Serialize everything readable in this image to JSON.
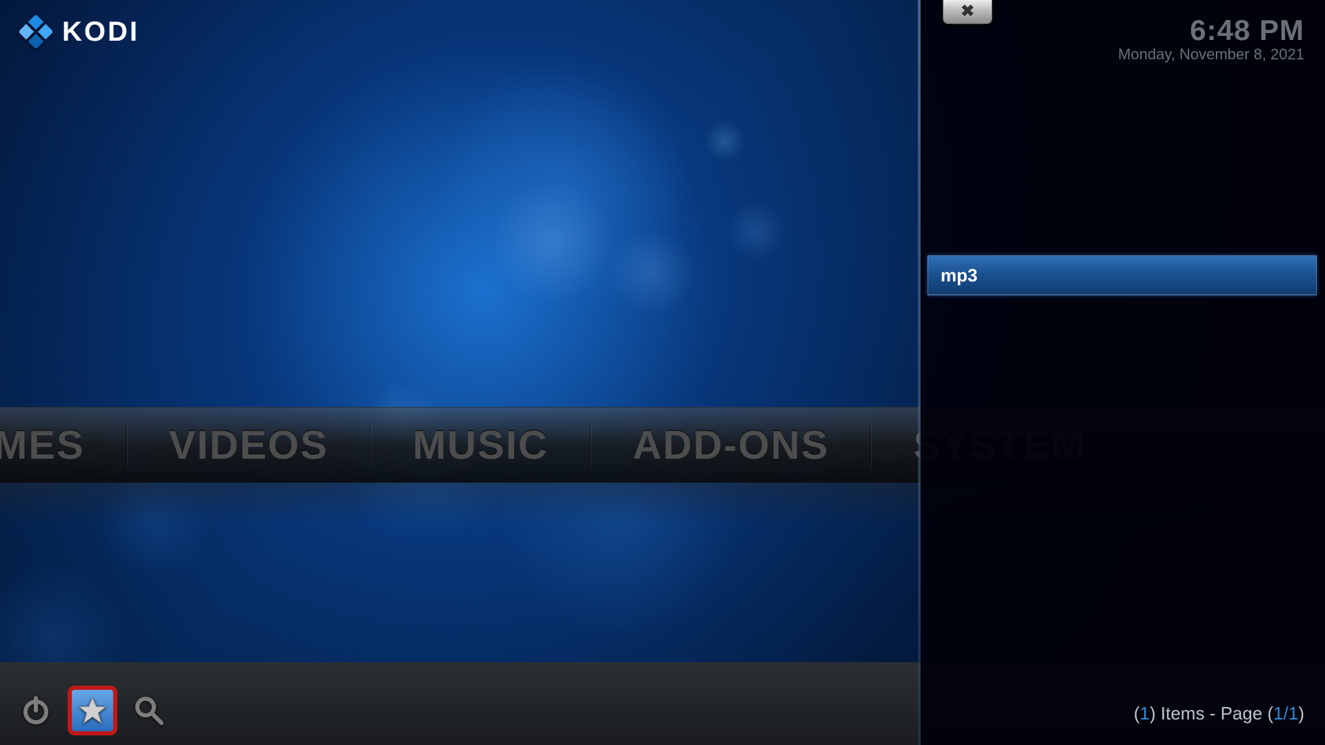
{
  "app": {
    "name": "KODI"
  },
  "clock": {
    "time": "6:48 PM",
    "date": "Monday, November 8, 2021"
  },
  "nav": {
    "items": [
      "GAMES",
      "VIDEOS",
      "MUSIC",
      "ADD-ONS",
      "SYSTEM"
    ]
  },
  "sidepanel": {
    "items": [
      {
        "label": "mp3"
      }
    ],
    "footer_prefix_count": "1",
    "footer_middle": ") Items - Page (",
    "footer_page": "1/1",
    "footer_close": ")",
    "footer_open": "("
  },
  "colors": {
    "accent": "#2e8bd8",
    "highlight_border": "#c01818"
  }
}
